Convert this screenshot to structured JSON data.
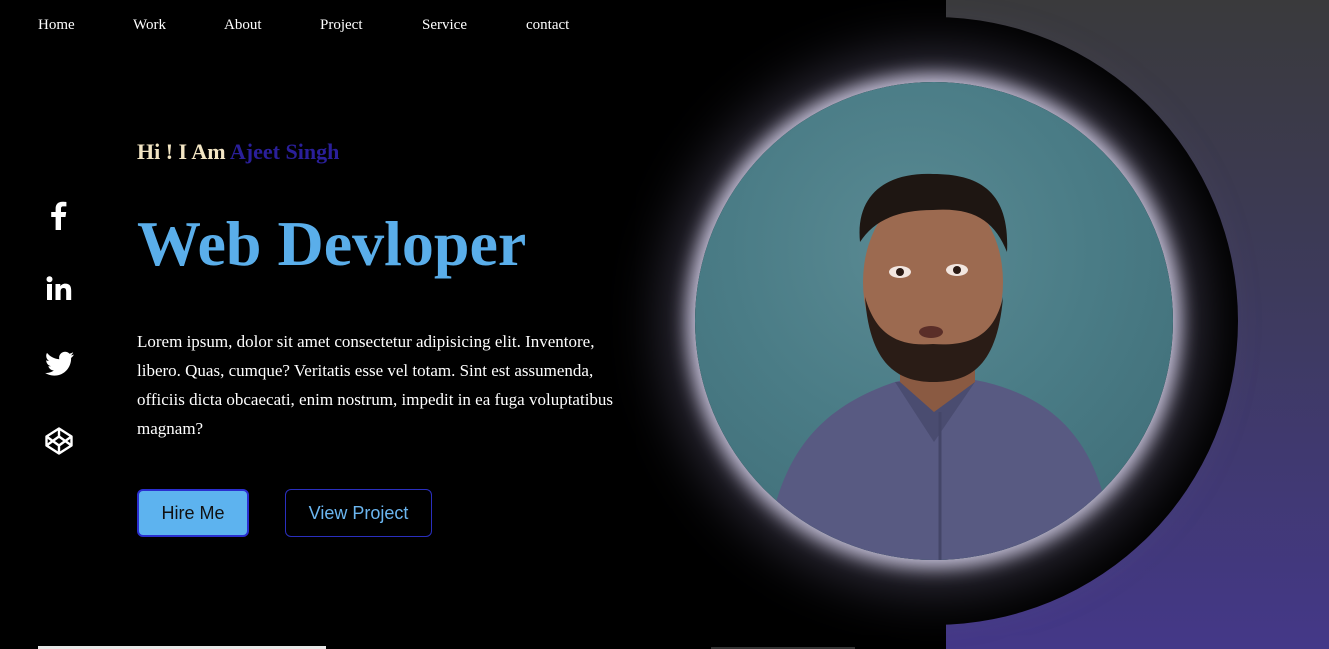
{
  "nav": {
    "items": [
      "Home",
      "Work",
      "About",
      "Project",
      "Service",
      "contact"
    ]
  },
  "social": {
    "icons": [
      "facebook-icon",
      "linkedin-icon",
      "twitter-icon",
      "codepen-icon"
    ]
  },
  "hero": {
    "greeting_prefix": "Hi ! I Am",
    "greeting_name": "Ajeet Singh",
    "headline": "Web Devloper",
    "description": "Lorem ipsum, dolor sit amet consectetur adipisicing elit. Inventore, libero. Quas, cumque? Veritatis esse vel totam. Sint est assumenda, officiis dicta obcaecati, enim nostrum, impedit in ea fuga voluptatibus magnam?",
    "hire_label": "Hire Me",
    "view_label": "View Project"
  },
  "colors": {
    "accent": "#5aaeea",
    "name": "#2a1f9a",
    "greeting": "#f3e6c4",
    "panel_bottom": "#443888"
  }
}
